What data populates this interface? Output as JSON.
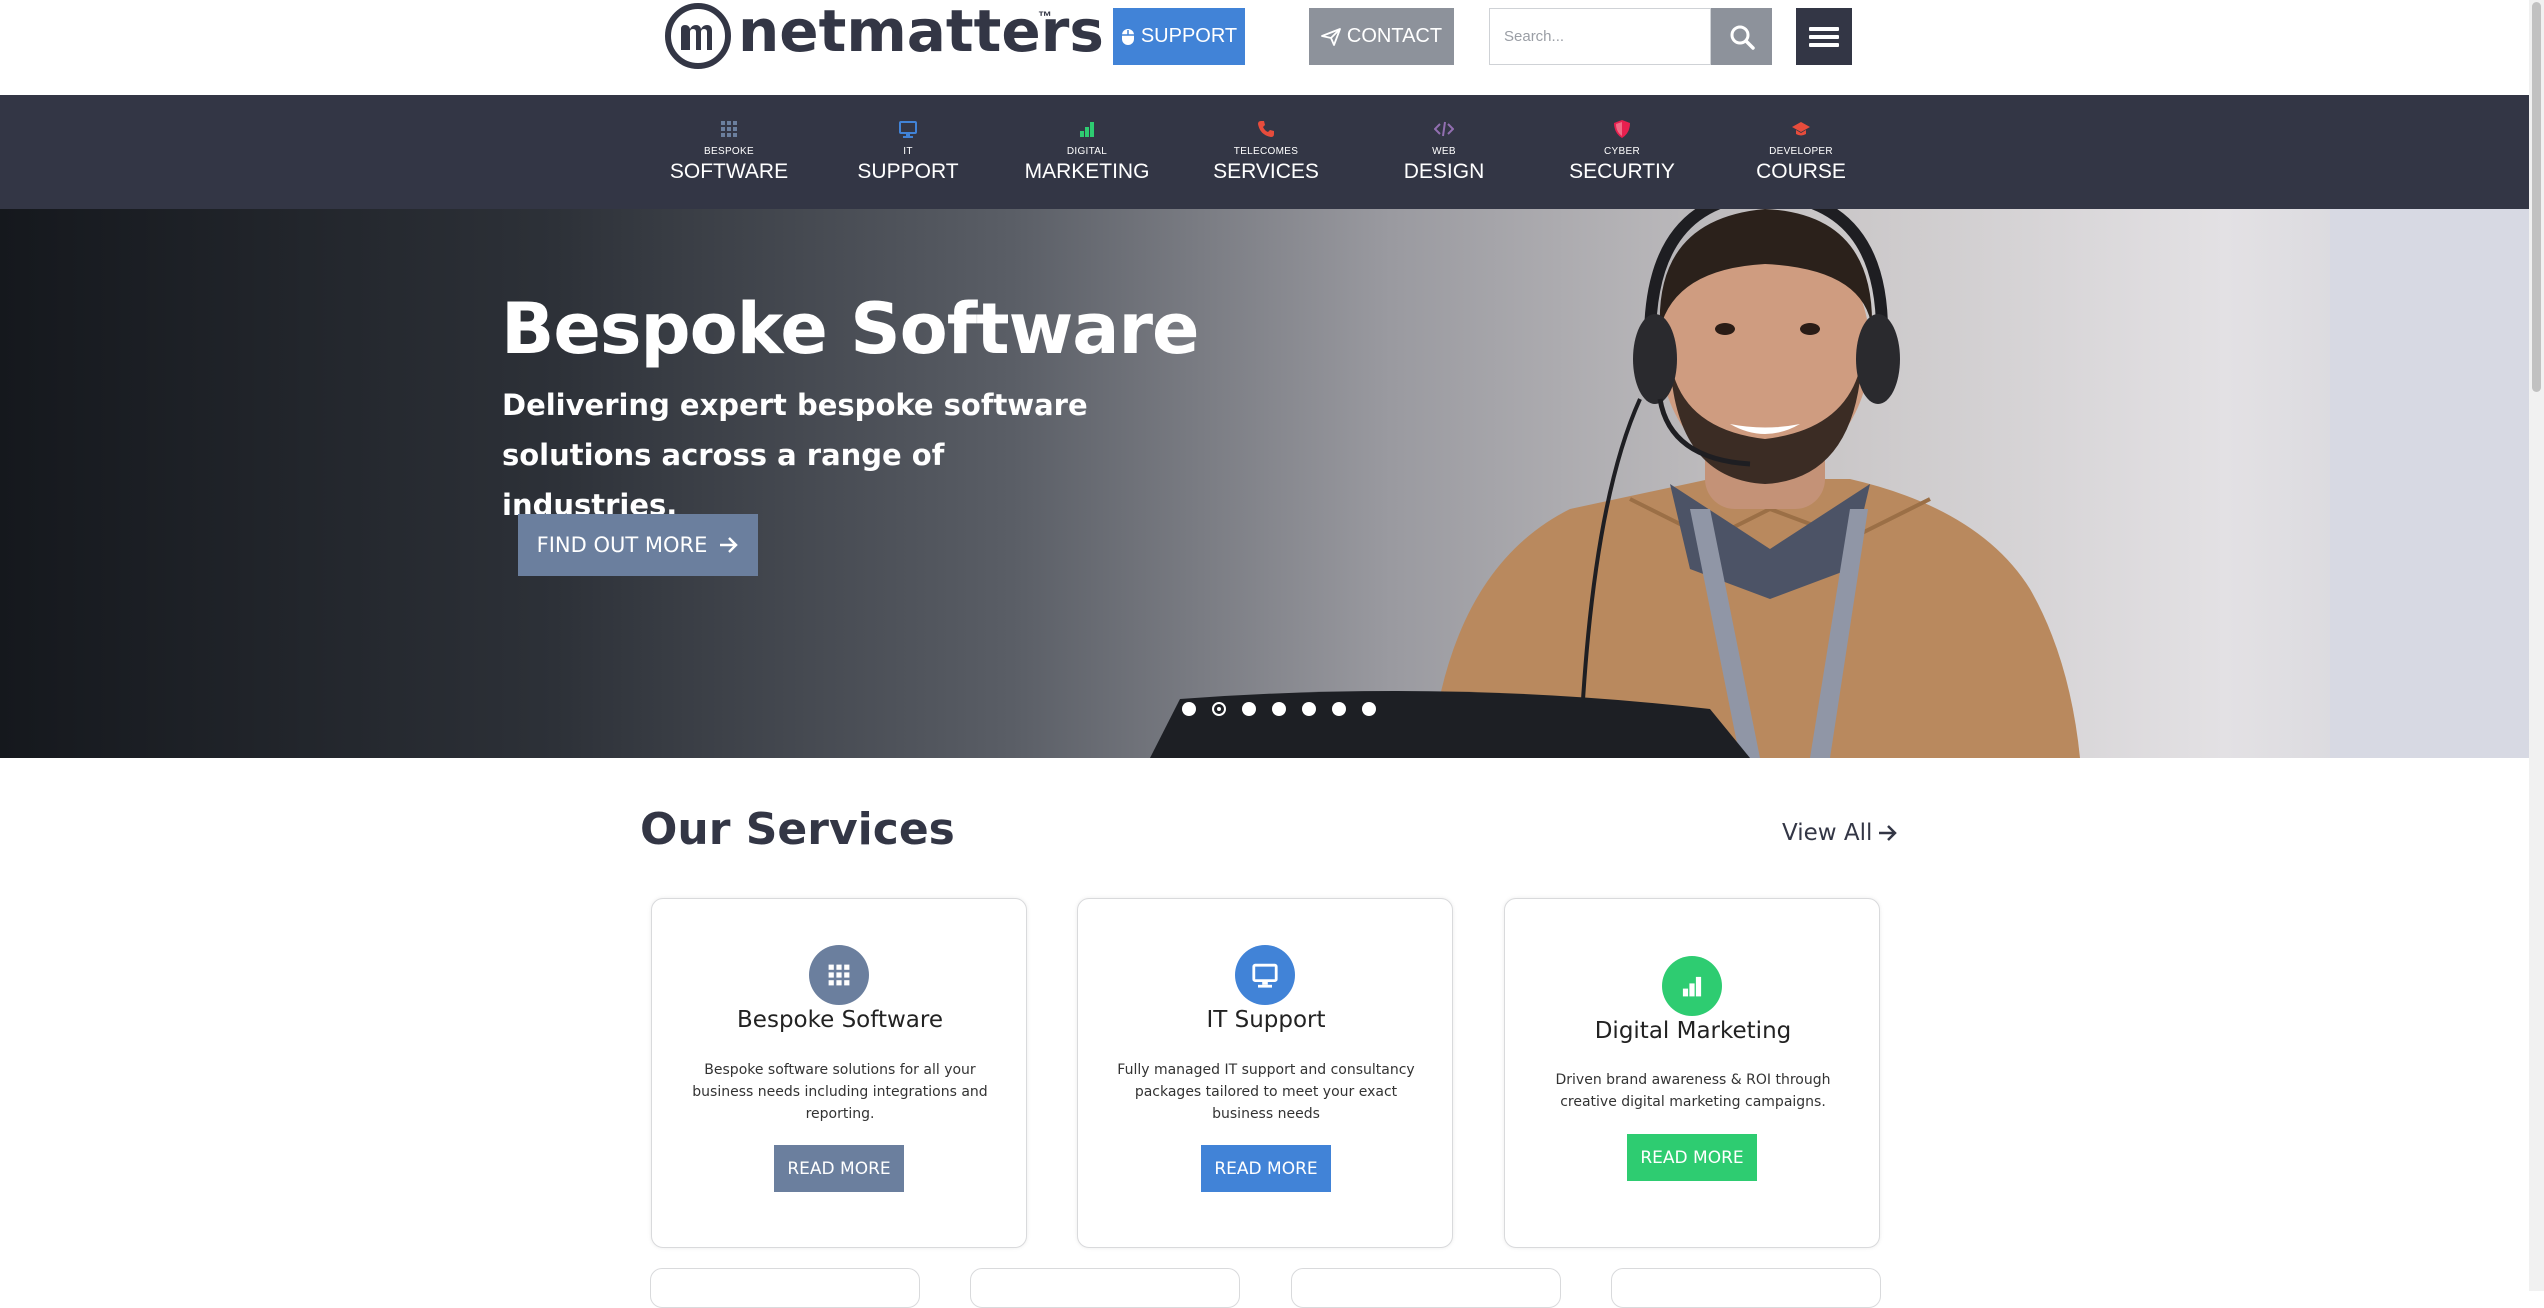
{
  "header": {
    "logo_text": "netmatters",
    "logo_tm": "™",
    "support_label": "SUPPORT",
    "contact_label": "CONTACT",
    "search_placeholder": "Search...",
    "search_icon": "search-icon",
    "menu_icon": "hamburger-menu-icon"
  },
  "nav": [
    {
      "small": "BESPOKE",
      "big": "SOFTWARE",
      "icon": "grid-icon",
      "color": "#6b7f9e"
    },
    {
      "small": "IT",
      "big": "SUPPORT",
      "icon": "monitor-icon",
      "color": "#4183d7"
    },
    {
      "small": "DIGITAL",
      "big": "MARKETING",
      "icon": "bar-chart-icon",
      "color": "#2ecc71"
    },
    {
      "small": "TELECOMES",
      "big": "SERVICES",
      "icon": "phone-icon",
      "color": "#e74c3c"
    },
    {
      "small": "WEB",
      "big": "DESIGN",
      "icon": "code-icon",
      "color": "#926fb1"
    },
    {
      "small": "CYBER",
      "big": "SECURTIY",
      "icon": "shield-icon",
      "color": "#e8204f"
    },
    {
      "small": "DEVELOPER",
      "big": "COURSE",
      "icon": "graduation-cap-icon",
      "color": "#e74c3c"
    }
  ],
  "hero": {
    "title": "Bespoke Software",
    "subtitle": "Delivering expert bespoke software solutions across a range of industries.",
    "button_label": "FIND OUT MORE",
    "slide_count": 7,
    "active_slide": 2
  },
  "services": {
    "title": "Our Services",
    "view_all": "View All",
    "cards": [
      {
        "title": "Bespoke Software",
        "desc": "Bespoke software solutions for all your business needs including integrations and reporting.",
        "button": "READ MORE",
        "color": "#6b7f9e",
        "icon": "grid-icon"
      },
      {
        "title": "IT Support",
        "desc": "Fully managed IT support and consultancy packages tailored to meet your exact business needs",
        "button": "READ MORE",
        "color": "#4183d7",
        "icon": "monitor-icon"
      },
      {
        "title": "Digital Marketing",
        "desc": "Driven brand awareness & ROI through creative digital marketing campaigns.",
        "button": "READ MORE",
        "color": "#2ecc71",
        "icon": "bar-chart-icon"
      }
    ]
  }
}
